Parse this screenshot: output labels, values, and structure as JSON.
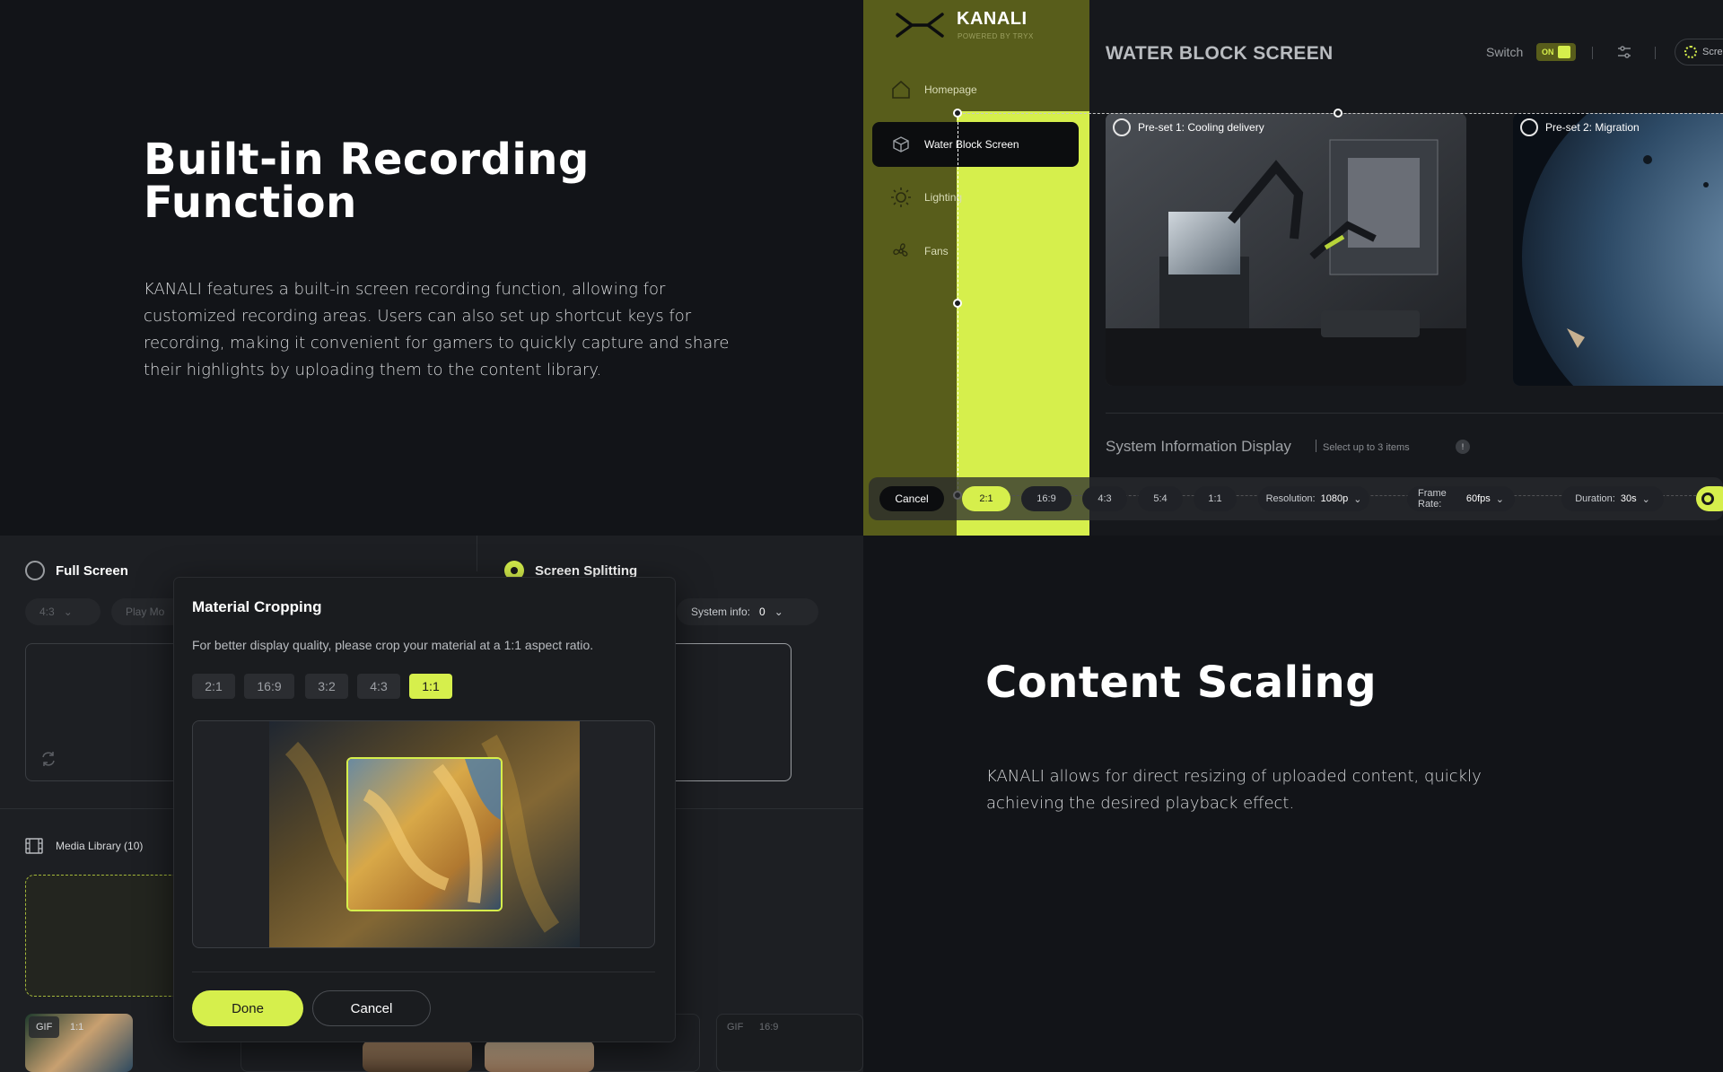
{
  "section1": {
    "title_line1": "Built-in Recording",
    "title_line2": "Function",
    "body": [
      "KANALI features a built-in screen recording function, allowing for",
      "customized recording areas. Users can also set up shortcut keys for",
      "recording, making it convenient for gamers to quickly capture and share",
      "their highlights by uploading them to the content library."
    ]
  },
  "app": {
    "logo": "KANALI",
    "logo_sub": "POWERED BY TRYX",
    "nav": [
      {
        "label": "Homepage",
        "icon": "home-icon"
      },
      {
        "label": "Water Block Screen",
        "icon": "cube-icon"
      },
      {
        "label": "Lighting",
        "icon": "sun-icon"
      },
      {
        "label": "Fans",
        "icon": "fan-icon"
      }
    ],
    "title": "WATER BLOCK SCREEN",
    "switch_label": "Switch",
    "switch_state": "ON",
    "top_right_partial": "Scre",
    "presets": [
      {
        "label": "Pre-set 1:  Cooling delivery"
      },
      {
        "label": "Pre-set 2:  Migration"
      }
    ],
    "sys_info_title": "System Information Display",
    "sys_info_hint": "Select up to 3 items",
    "sys_info_badge": "!",
    "toolbar": {
      "cancel": "Cancel",
      "ratios": [
        "2:1",
        "16:9",
        "4:3",
        "5:4",
        "1:1"
      ],
      "active_ratio": "2:1",
      "resolution_label": "Resolution:",
      "resolution_value": "1080p",
      "framerate_label": "Frame Rate:",
      "framerate_value": "60fps",
      "duration_label": "Duration:",
      "duration_value": "30s"
    },
    "accent": "#D6EF4C"
  },
  "editor": {
    "full_screen": "Full Screen",
    "screen_splitting": "Screen Splitting",
    "ratio_pill": "4:3",
    "play_mode_pill": "Play Mo",
    "system_info_label": "System info:",
    "system_info_value": "0",
    "media_library": "Media Library (10)",
    "thumb_tags": [
      [
        "GIF",
        "1:1"
      ],
      [
        "GIF",
        "16:9"
      ]
    ]
  },
  "dialog": {
    "title": "Material Cropping",
    "description": "For better display quality, please crop your material at a 1:1 aspect ratio.",
    "ratios": [
      "2:1",
      "16:9",
      "3:2",
      "4:3",
      "1:1"
    ],
    "active_ratio": "1:1",
    "done": "Done",
    "cancel": "Cancel"
  },
  "section2": {
    "title": "Content Scaling",
    "body": [
      "KANALI allows for direct resizing of uploaded content, quickly",
      "achieving the desired playback effect."
    ]
  }
}
